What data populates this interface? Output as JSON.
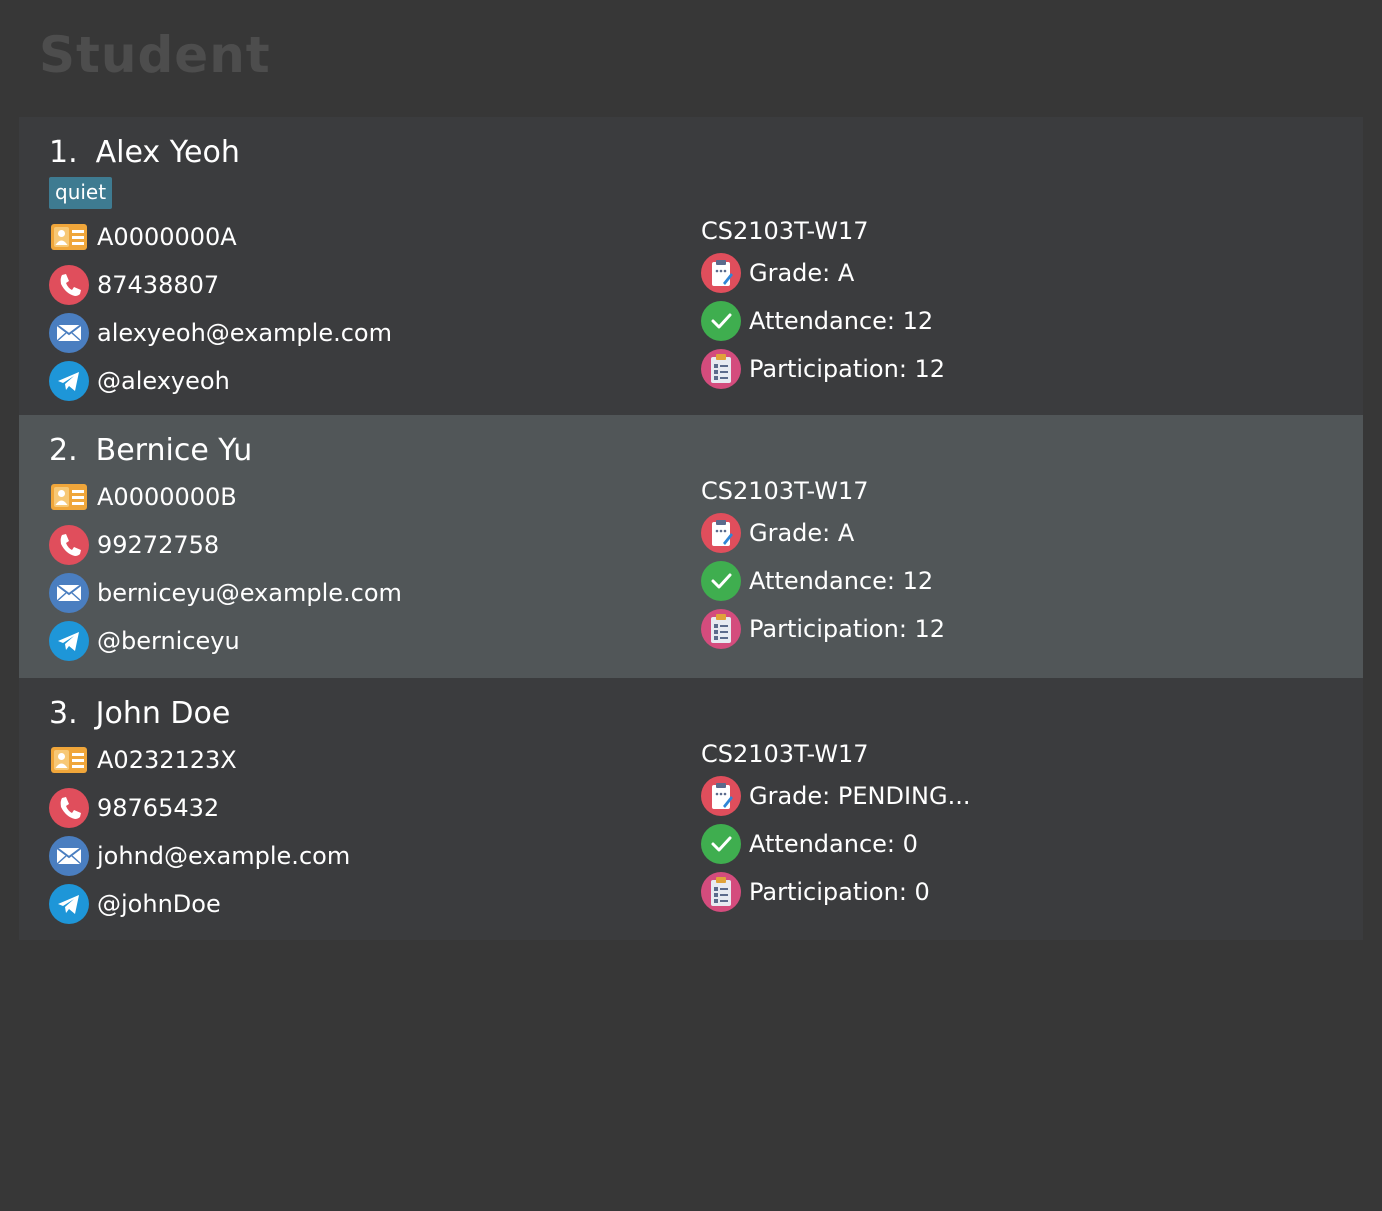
{
  "panel": {
    "title": "Student"
  },
  "students": [
    {
      "index": "1.",
      "name": "Alex Yeoh",
      "tags": [
        "quiet"
      ],
      "student_id": "A0000000A",
      "phone": "87438807",
      "email": "alexyeoh@example.com",
      "telegram": "@alexyeoh",
      "tutorial_group": "CS2103T-W17",
      "grade": "Grade: A",
      "attendance": "Attendance: 12",
      "participation": "Participation: 12"
    },
    {
      "index": "2.",
      "name": "Bernice Yu",
      "tags": [],
      "student_id": "A0000000B",
      "phone": "99272758",
      "email": "berniceyu@example.com",
      "telegram": "@berniceyu",
      "tutorial_group": "CS2103T-W17",
      "grade": "Grade: A",
      "attendance": "Attendance: 12",
      "participation": "Participation: 12"
    },
    {
      "index": "3.",
      "name": "John Doe",
      "tags": [],
      "student_id": "A0232123X",
      "phone": "98765432",
      "email": "johnd@example.com",
      "telegram": "@johnDoe",
      "tutorial_group": "CS2103T-W17",
      "grade": "Grade: PENDING...",
      "attendance": "Attendance: 0",
      "participation": "Participation: 0"
    }
  ],
  "icons": {
    "student_id": "id-card-icon",
    "phone": "phone-icon",
    "email": "email-icon",
    "telegram": "telegram-icon",
    "grade": "grade-clipboard-icon",
    "attendance": "attendance-check-icon",
    "participation": "participation-clipboard-icon"
  },
  "colors": {
    "background": "#373737",
    "card_default": "#3b3c3e",
    "card_selected": "#515658",
    "tag": "#3e7b91",
    "title": "#4d4d4d"
  }
}
